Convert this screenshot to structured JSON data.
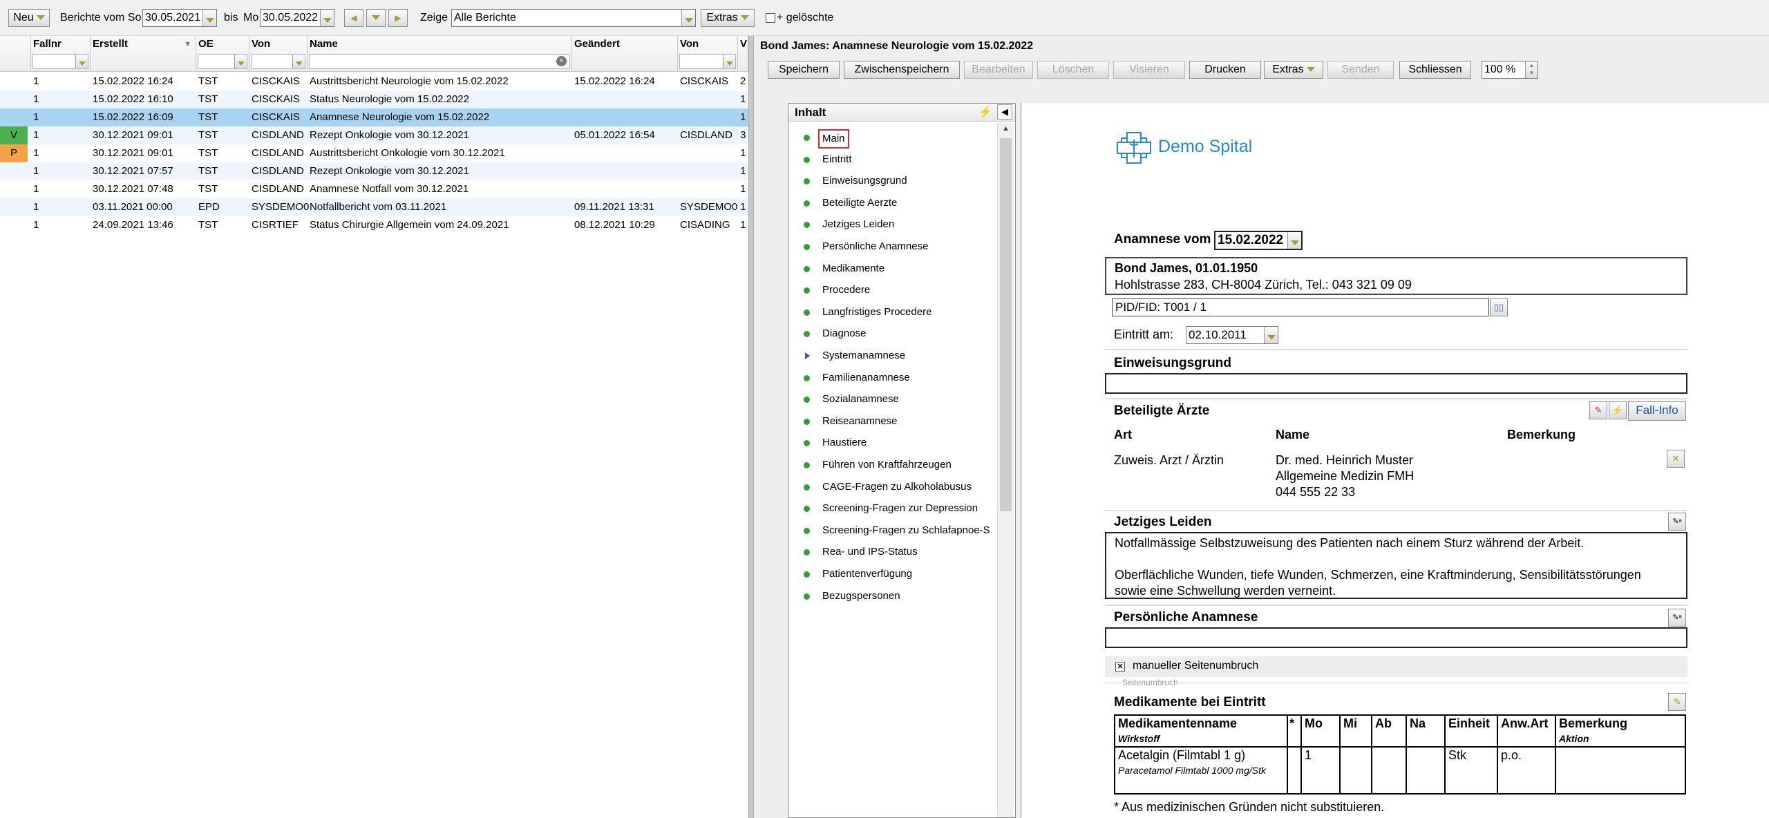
{
  "toolbar": {
    "new_label": "Neu",
    "reports_from_label": "Berichte vom So",
    "date_from": "30.05.2021",
    "to_label": "bis",
    "to_day_label": "Mo",
    "date_to": "30.05.2022",
    "show_label": "Zeige",
    "show_value": "Alle Berichte",
    "extras_label": "Extras",
    "deleted_label": "+ gelöschte"
  },
  "list": {
    "columns": [
      "Fallnr",
      "Erstellt",
      "OE",
      "Von",
      "Name",
      "Geändert",
      "Von",
      "V"
    ],
    "rows": [
      {
        "mark": "",
        "fallnr": "1",
        "erstellt": "15.02.2022 16:24",
        "oe": "TST",
        "von": "CISCKAIS",
        "name": "Austrittsbericht Neurologie vom 15.02.2022",
        "geaendert": "15.02.2022 16:24",
        "von2": "CISCKAIS",
        "v": "2"
      },
      {
        "mark": "",
        "fallnr": "1",
        "erstellt": "15.02.2022 16:10",
        "oe": "TST",
        "von": "CISCKAIS",
        "name": "Status Neurologie vom 15.02.2022",
        "geaendert": "",
        "von2": "",
        "v": "1"
      },
      {
        "mark": "",
        "fallnr": "1",
        "erstellt": "15.02.2022 16:09",
        "oe": "TST",
        "von": "CISCKAIS",
        "name": "Anamnese Neurologie vom 15.02.2022",
        "geaendert": "",
        "von2": "",
        "v": "1"
      },
      {
        "mark": "V",
        "fallnr": "1",
        "erstellt": "30.12.2021 09:01",
        "oe": "TST",
        "von": "CISDLAND",
        "name": "Rezept Onkologie vom 30.12.2021",
        "geaendert": "05.01.2022 16:54",
        "von2": "CISDLAND",
        "v": "3"
      },
      {
        "mark": "P",
        "fallnr": "1",
        "erstellt": "30.12.2021 09:01",
        "oe": "TST",
        "von": "CISDLAND",
        "name": "Austrittsbericht Onkologie vom 30.12.2021",
        "geaendert": "",
        "von2": "",
        "v": "1"
      },
      {
        "mark": "",
        "fallnr": "1",
        "erstellt": "30.12.2021 07:57",
        "oe": "TST",
        "von": "CISDLAND",
        "name": "Rezept Onkologie vom 30.12.2021",
        "geaendert": "",
        "von2": "",
        "v": "1"
      },
      {
        "mark": "",
        "fallnr": "1",
        "erstellt": "30.12.2021 07:48",
        "oe": "TST",
        "von": "CISDLAND",
        "name": "Anamnese Notfall vom 30.12.2021",
        "geaendert": "",
        "von2": "",
        "v": "1"
      },
      {
        "mark": "",
        "fallnr": "1",
        "erstellt": "03.11.2021 00:00",
        "oe": "EPD",
        "von": "SYSDEMO0",
        "name": "Notfallbericht vom 03.11.2021",
        "geaendert": "09.11.2021 13:31",
        "von2": "SYSDEMO0",
        "v": "1"
      },
      {
        "mark": "",
        "fallnr": "1",
        "erstellt": "24.09.2021 13:46",
        "oe": "TST",
        "von": "CISRTIEF",
        "name": "Status Chirurgie Allgemein vom 24.09.2021",
        "geaendert": "08.12.2021 10:29",
        "von2": "CISADING",
        "v": "1"
      }
    ]
  },
  "report": {
    "title": "Bond James: Anamnese Neurologie vom 15.02.2022",
    "buttons": {
      "save": "Speichern",
      "save_draft": "Zwischenspeichern",
      "edit": "Bearbeiten",
      "delete": "Löschen",
      "approve": "Visieren",
      "print": "Drucken",
      "extras": "Extras",
      "send": "Senden",
      "close": "Schliessen"
    },
    "zoom": "100 %"
  },
  "toc": {
    "title": "Inhalt",
    "items": [
      "Main",
      "Eintritt",
      "Einweisungsgrund",
      "Beteiligte Aerzte",
      "Jetziges Leiden",
      "Persönliche Anamnese",
      "Medikamente",
      "Procedere",
      "Langfristiges Procedere",
      "Diagnose",
      "Systemanamnese",
      "Familienanamnese",
      "Sozialanamnese",
      "Reiseanamnese",
      "Haustiere",
      "Führen von Kraftfahrzeugen",
      "CAGE-Fragen zu Alkoholabusus",
      "Screening-Fragen zur Depression",
      "Screening-Fragen zu Schlafapnoe-S",
      "Rea- und IPS-Status",
      "Patientenverfügung",
      "Bezugspersonen"
    ]
  },
  "doc": {
    "logo_text": "Demo Spital",
    "anamnese_label": "Anamnese vom",
    "anamnese_date": "15.02.2022",
    "patient_name": "Bond James, 01.01.1950",
    "patient_address": "Hohlstrasse 283, CH-8004 Zürich, Tel.: 043 321 09 09",
    "pid": "PID/FID: T001 / 1",
    "eintritt_label": "Eintritt am:",
    "eintritt_date": "02.10.2011",
    "einweisung_heading": "Einweisungsgrund",
    "aerzte_heading": "Beteiligte Ärzte",
    "fall_info": "Fall-Info",
    "col_art": "Art",
    "col_name": "Name",
    "col_bemerkung": "Bemerkung",
    "arzt_art": "Zuweis. Arzt / Ärztin",
    "arzt_name": "Dr. med. Heinrich Muster",
    "arzt_spec": "Allgemeine Medizin FMH",
    "arzt_phone": "044 555 22 33",
    "leiden_heading": "Jetziges Leiden",
    "leiden_line1": "Notfallmässige Selbstzuweisung des Patienten nach einem Sturz während der Arbeit.",
    "leiden_line2": "Oberflächliche Wunden, tiefe Wunden, Schmerzen, eine Kraftminderung, Sensibilitätsstörungen",
    "leiden_line3": "sowie eine Schwellung werden verneint.",
    "anamnese_heading": "Persönliche Anamnese",
    "page_break_label": "manueller Seitenumbruch",
    "page_break_sub": "Seitenumbruch",
    "med_heading": "Medikamente bei Eintritt",
    "med_cols": {
      "name": "Medikamentenname",
      "wirkstoff": "Wirkstoff",
      "star": "*",
      "mo": "Mo",
      "mi": "Mi",
      "ab": "Ab",
      "na": "Na",
      "einheit": "Einheit",
      "anw": "Anw.Art",
      "bem": "Bemerkung",
      "aktion": "Aktion"
    },
    "med_row": {
      "name": "Acetalgin (Filmtabl 1 g)",
      "wirkstoff": "Paracetamol Filmtabl 1000 mg/Stk",
      "mo": "1",
      "einheit": "Stk",
      "anw": "p.o."
    },
    "footnote": "* Aus medizinischen Gründen nicht substituieren."
  },
  "colors": {
    "selected_row": "#a8d4f2",
    "alt_row": "#eef5fb",
    "mark_v": "#4caf50",
    "mark_p": "#f5a04a",
    "toc_dot": "#3a9a3a"
  }
}
